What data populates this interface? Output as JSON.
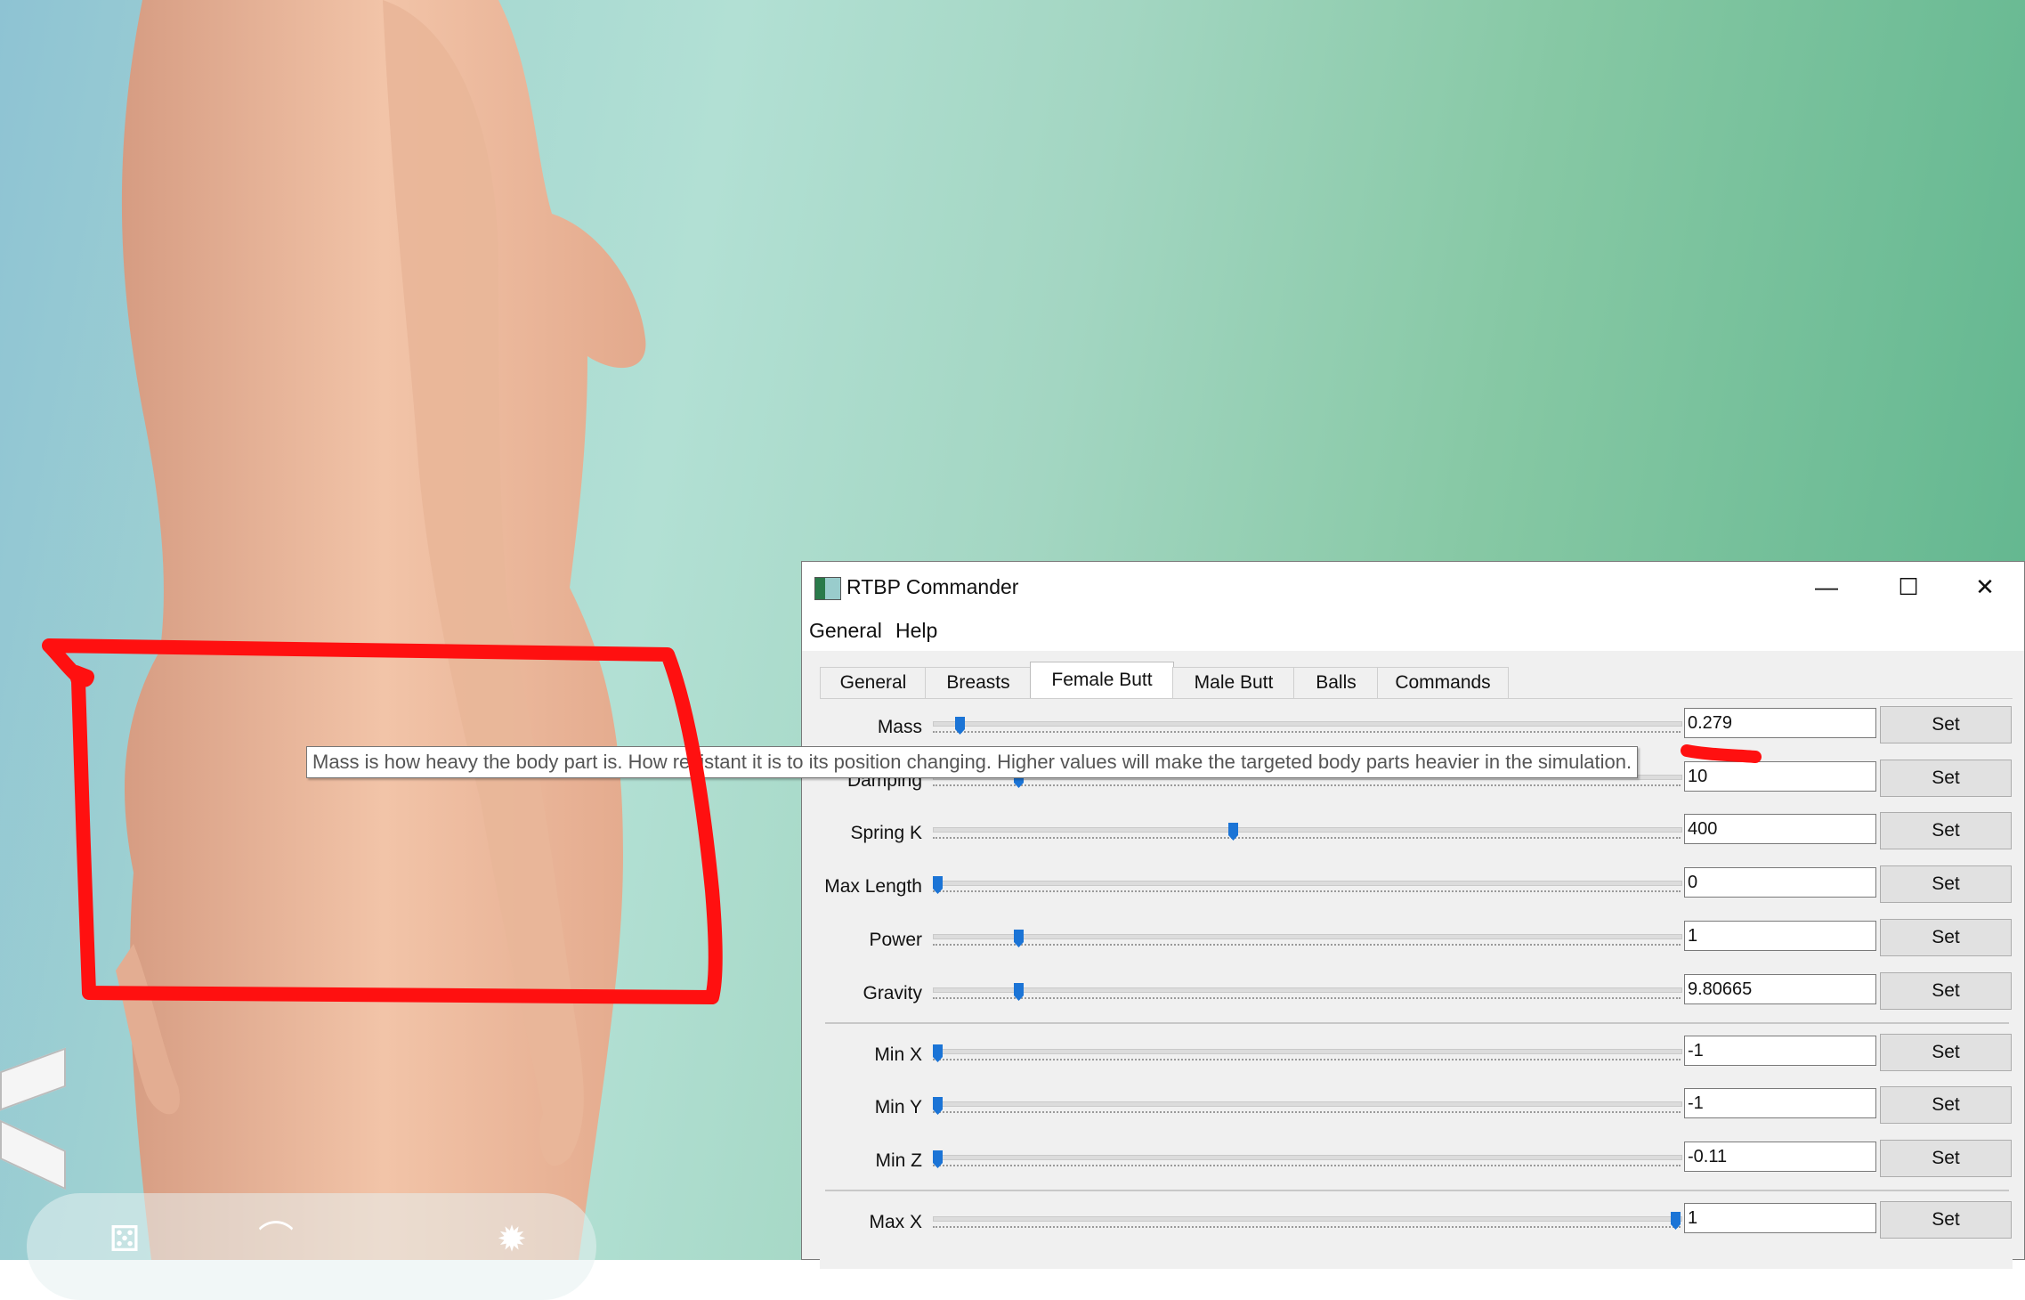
{
  "window": {
    "title": "RTBP Commander",
    "controls": {
      "minimize": "—",
      "maximize": "☐",
      "close": "✕"
    }
  },
  "menu": [
    "General",
    "Help"
  ],
  "tabs": [
    "General",
    "Breasts",
    "Female Butt",
    "Male Butt",
    "Balls",
    "Commands"
  ],
  "active_tab": "Female Butt",
  "set_label": "Set",
  "rows": [
    {
      "label": "Mass",
      "value": "0.279",
      "slider_pos": 0.03
    },
    {
      "label": "Damping",
      "value": "10",
      "slider_pos": 0.11
    },
    {
      "label": "Spring K",
      "value": "400",
      "slider_pos": 0.4
    },
    {
      "label": "Max Length",
      "value": "0",
      "slider_pos": 0.0
    },
    {
      "label": "Power",
      "value": "1",
      "slider_pos": 0.11
    },
    {
      "label": "Gravity",
      "value": "9.80665",
      "slider_pos": 0.11
    },
    {
      "label": "Min X",
      "value": "-1",
      "slider_pos": 0.0
    },
    {
      "label": "Min Y",
      "value": "-1",
      "slider_pos": 0.0
    },
    {
      "label": "Min Z",
      "value": "-0.11",
      "slider_pos": 0.0
    },
    {
      "label": "Max X",
      "value": "1",
      "slider_pos": 1.0
    }
  ],
  "tooltip": "Mass is how heavy the body part is. How resistant it is to its position changing. Higher values will make the targeted body parts heavier in the simulation.",
  "colors": {
    "slider_thumb": "#1b74d6",
    "annotation_red": "#ff1010"
  },
  "game_icons": [
    "dice-icon",
    "hanger-icon",
    "star-burst-icon"
  ]
}
